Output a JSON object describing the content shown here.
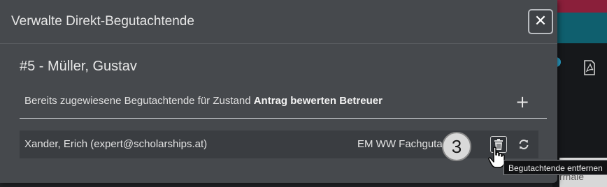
{
  "background": {
    "peek_text": "rmale",
    "pdf_icon": "pdf-file-icon"
  },
  "modal": {
    "title": "Verwalte Direkt-Begutachtende",
    "close_icon": "close-icon",
    "entity_title": "#5 - Müller, Gustav",
    "assigned_label_prefix": "Bereits zugewiesene Begutachtende für Zustand ",
    "assigned_label_state": "Antrag bewerten Betreuer",
    "add_icon": "plus-icon"
  },
  "reviewers": [
    {
      "name": "Xander, Erich (expert@scholarships.at)",
      "role": "EM WW Fachgutachten",
      "actions": [
        "trash-icon",
        "refresh-icon"
      ]
    }
  ],
  "annotation": {
    "step_number": "3",
    "tooltip": "Begutachtende entfernen"
  },
  "colors": {
    "modal_bg": "#46494d",
    "row_bg": "#3a3d41",
    "accent_red": "#8a1f3a",
    "accent_teal": "#0f5f6e"
  }
}
